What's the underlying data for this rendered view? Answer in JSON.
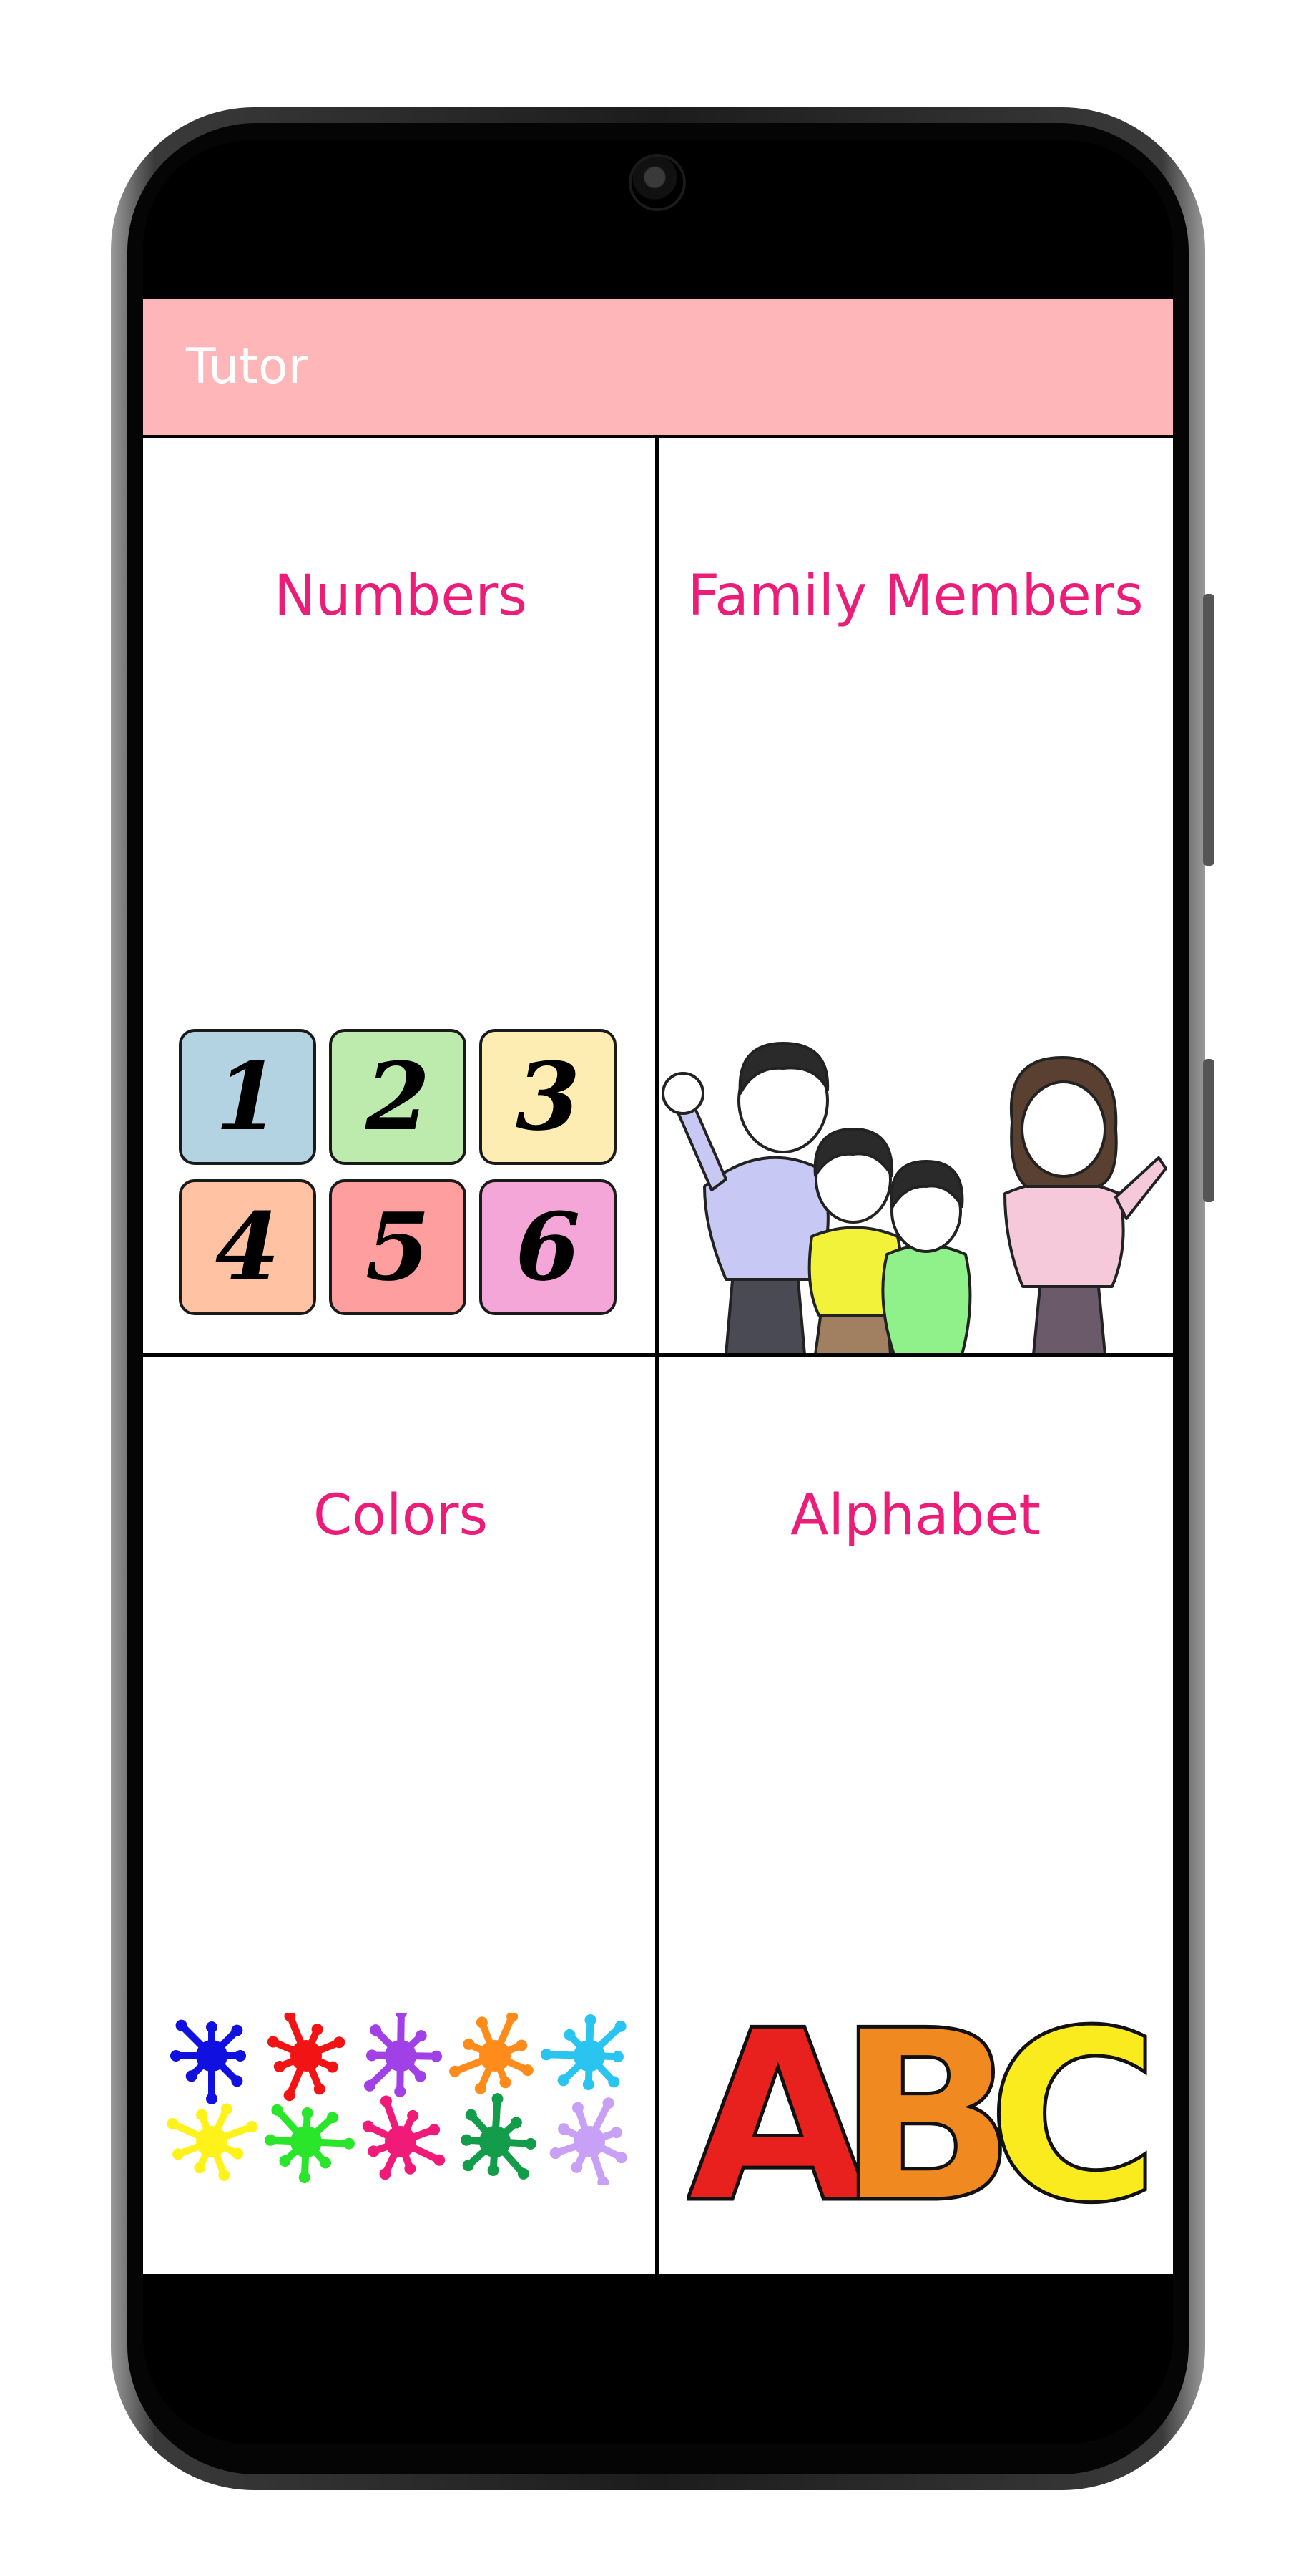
{
  "app": {
    "title": "Tutor",
    "colors": {
      "app_bar": "#FFB6B9",
      "accent_text": "#EC1D78"
    }
  },
  "categories": [
    {
      "label": "Numbers",
      "illustration": "number-tiles-illustration"
    },
    {
      "label": "Family Members",
      "illustration": "family-illustration"
    },
    {
      "label": "Colors",
      "illustration": "paint-splats-illustration"
    },
    {
      "label": "Alphabet",
      "illustration": "abc-letters-illustration"
    }
  ],
  "number_tiles": [
    {
      "digit": "1",
      "color": "#B3D3E3"
    },
    {
      "digit": "2",
      "color": "#BDEBAD"
    },
    {
      "digit": "3",
      "color": "#FDEDB3"
    },
    {
      "digit": "4",
      "color": "#FFC3A3"
    },
    {
      "digit": "5",
      "color": "#FF9E9E"
    },
    {
      "digit": "6",
      "color": "#F4A6D8"
    }
  ],
  "splat_colors": [
    "#1010E0",
    "#F21414",
    "#A040E6",
    "#FF8C1A",
    "#2AC4F0",
    "#FFF21A",
    "#2AE62A",
    "#F01A78",
    "#139C4A",
    "#C8A0F5"
  ],
  "abc_letters": [
    {
      "letter": "A",
      "color": "#E8201E"
    },
    {
      "letter": "B",
      "color": "#F08A20"
    },
    {
      "letter": "C",
      "color": "#FAEB1E"
    }
  ]
}
